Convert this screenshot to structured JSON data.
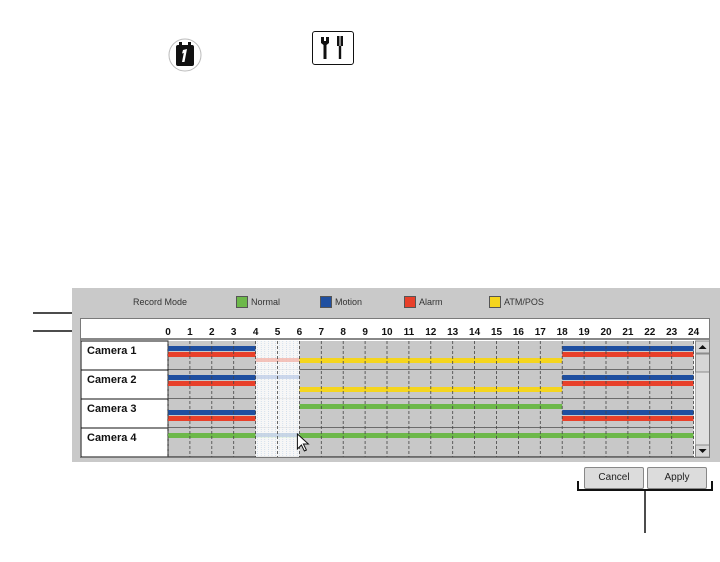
{
  "legend": {
    "title": "Record Mode",
    "items": [
      {
        "label": "Normal",
        "color": "#6db84a"
      },
      {
        "label": "Motion",
        "color": "#1f4fa0"
      },
      {
        "label": "Alarm",
        "color": "#e8402a"
      },
      {
        "label": "ATM/POS",
        "color": "#f5d51e"
      }
    ]
  },
  "hours": [
    "0",
    "1",
    "2",
    "3",
    "4",
    "5",
    "6",
    "7",
    "8",
    "9",
    "10",
    "11",
    "12",
    "13",
    "14",
    "15",
    "16",
    "17",
    "18",
    "19",
    "20",
    "21",
    "22",
    "23",
    "24"
  ],
  "cameras": [
    {
      "label": "Camera 1"
    },
    {
      "label": "Camera 2"
    },
    {
      "label": "Camera 3"
    },
    {
      "label": "Camera 4"
    }
  ],
  "buttons": {
    "cancel": "Cancel",
    "apply": "Apply"
  },
  "colors": {
    "grid_bg": "#c8c8c8",
    "selection": "#ffffff"
  }
}
